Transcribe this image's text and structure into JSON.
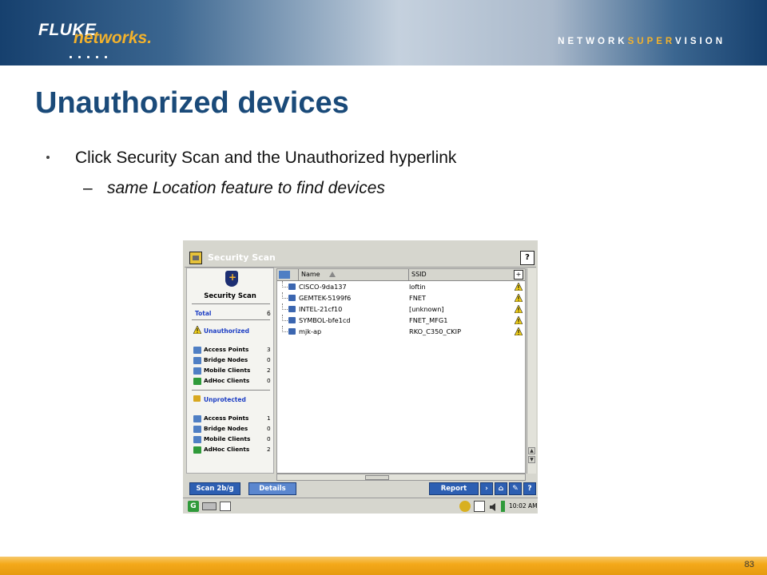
{
  "slide": {
    "brand_fluke": "FLUKE",
    "brand_networks": "networks.",
    "tagline_pre": "NETWORK",
    "tagline_mid": "SUPER",
    "tagline_post": "VISION",
    "title": "Unauthorized devices",
    "bullet": "Click Security Scan and the Unauthorized hyperlink",
    "subbullet_dash": "–",
    "subbullet": "same Location feature to find devices",
    "page_number": "83",
    "colors": {
      "title": "#1a4a79",
      "accent": "#f4a91a",
      "band": "#16406e"
    }
  },
  "app": {
    "window_title": "Security Scan",
    "help_glyph": "?",
    "left_panel": {
      "title": "Security Scan",
      "total_label": "Total",
      "total_value": "6",
      "unauthorized_label": "Unauthorized",
      "unauthorized_items": [
        {
          "label": "Access Points",
          "value": "3",
          "icon": "access-point-icon"
        },
        {
          "label": "Bridge Nodes",
          "value": "0",
          "icon": "bridge-node-icon"
        },
        {
          "label": "Mobile Clients",
          "value": "2",
          "icon": "mobile-client-icon"
        },
        {
          "label": "AdHoc Clients",
          "value": "0",
          "icon": "adhoc-client-icon"
        }
      ],
      "unprotected_label": "Unprotected",
      "unprotected_items": [
        {
          "label": "Access Points",
          "value": "1",
          "icon": "access-point-icon"
        },
        {
          "label": "Bridge Nodes",
          "value": "0",
          "icon": "bridge-node-icon"
        },
        {
          "label": "Mobile Clients",
          "value": "0",
          "icon": "mobile-client-icon"
        },
        {
          "label": "AdHoc Clients",
          "value": "2",
          "icon": "adhoc-client-icon"
        }
      ]
    },
    "grid": {
      "col_name": "Name",
      "col_ssid": "SSID",
      "rows": [
        {
          "name": "CISCO-9da137",
          "ssid": "loftin"
        },
        {
          "name": "GEMTEK-5199f6",
          "ssid": "FNET"
        },
        {
          "name": "INTEL-21cf10",
          "ssid": "[unknown]"
        },
        {
          "name": "SYMBOL-bfe1cd",
          "ssid": "FNET_MFG1"
        },
        {
          "name": "mjk-ap",
          "ssid": "RKO_C350_CKIP"
        }
      ]
    },
    "buttons": {
      "scan": "Scan 2b/g",
      "details": "Details",
      "report": "Report",
      "help": "?"
    },
    "taskbar": {
      "clock": "10:02 AM"
    }
  }
}
